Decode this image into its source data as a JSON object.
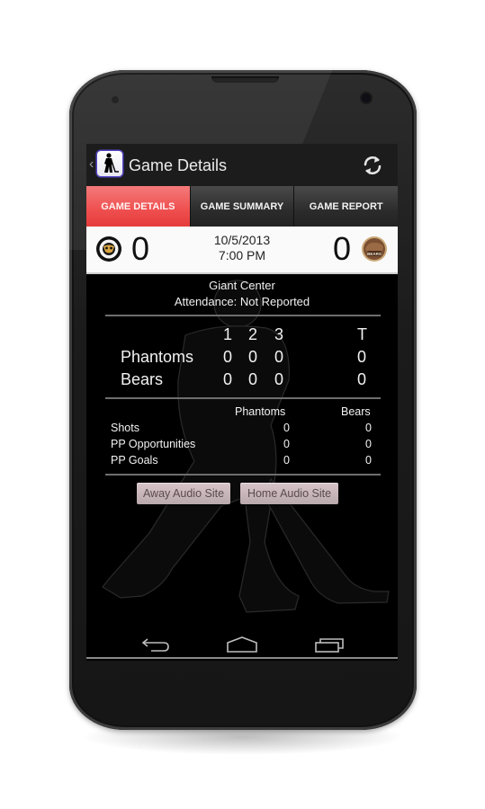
{
  "app": {
    "title": "Game Details",
    "back_glyph": "‹",
    "app_icon": "hockey-player-icon",
    "refresh_icon": "refresh-icon"
  },
  "tabs": [
    {
      "label": "GAME DETAILS",
      "active": true
    },
    {
      "label": "GAME SUMMARY",
      "active": false
    },
    {
      "label": "GAME REPORT",
      "active": false
    }
  ],
  "scoreboard": {
    "away": {
      "team": "Phantoms",
      "score": "0",
      "logo": "phantoms-logo-icon"
    },
    "home": {
      "team": "Bears",
      "score": "0",
      "logo": "bears-logo-icon"
    },
    "date": "10/5/2013",
    "time": "7:00 PM"
  },
  "venue": {
    "name": "Giant Center",
    "attendance": "Attendance: Not Reported"
  },
  "periods": {
    "headers": [
      "1",
      "2",
      "3",
      "T"
    ],
    "rows": [
      {
        "team": "Phantoms",
        "values": [
          "0",
          "0",
          "0",
          "0"
        ]
      },
      {
        "team": "Bears",
        "values": [
          "0",
          "0",
          "0",
          "0"
        ]
      }
    ]
  },
  "stats": {
    "columns": [
      "Phantoms",
      "Bears"
    ],
    "rows": [
      {
        "label": "Shots",
        "values": [
          "0",
          "0"
        ]
      },
      {
        "label": "PP Opportunities",
        "values": [
          "0",
          "0"
        ]
      },
      {
        "label": "PP Goals",
        "values": [
          "0",
          "0"
        ]
      }
    ]
  },
  "buttons": {
    "away_audio": "Away Audio Site",
    "home_audio": "Home Audio Site"
  },
  "navbar": {
    "back": "back-icon",
    "home": "home-icon",
    "recents": "recent-apps-icon"
  },
  "colors": {
    "active_tab": "#ef4f4f",
    "action_bar": "#1c1c1c",
    "button": "#c9b7bb"
  }
}
